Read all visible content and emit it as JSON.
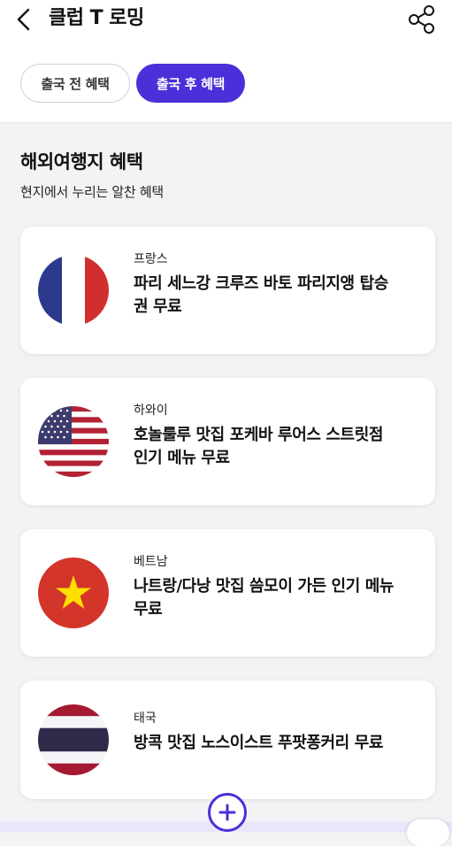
{
  "header": {
    "title": "클럽 T 로밍",
    "back_icon": "back-chevron-icon",
    "share_icon": "share-icon"
  },
  "tabs": [
    {
      "label": "출국 전 혜택",
      "selected": false
    },
    {
      "label": "출국 후 혜택",
      "selected": true
    }
  ],
  "section": {
    "title": "해외여행지 혜택",
    "subtitle": "현지에서 누리는 알찬 혜택"
  },
  "cards": [
    {
      "country": "프랑스",
      "benefit_line1": "파리 세느강 크루즈 바토 파리지앵 탑승",
      "benefit_line2": "권 무료",
      "flag_icon": "france-flag-icon"
    },
    {
      "country": "하와이",
      "benefit_line1": "호놀룰루 맛집 포케바 루어스 스트릿점",
      "benefit_line2": "인기 메뉴 무료",
      "flag_icon": "usa-flag-icon"
    },
    {
      "country": "베트남",
      "benefit_line1": "나트랑/다낭 맛집 씀모이 가든 인기 메뉴",
      "benefit_line2": "무료",
      "flag_icon": "vietnam-flag-icon"
    },
    {
      "country": "태국",
      "benefit_line1": "방콕 맛집 노스이스트 푸팟퐁커리 무료",
      "benefit_line2": "",
      "flag_icon": "thailand-flag-icon"
    }
  ],
  "colors": {
    "accent": "#4c2fd8",
    "background": "#f3f3f6"
  },
  "fab_icon": "plus-icon"
}
